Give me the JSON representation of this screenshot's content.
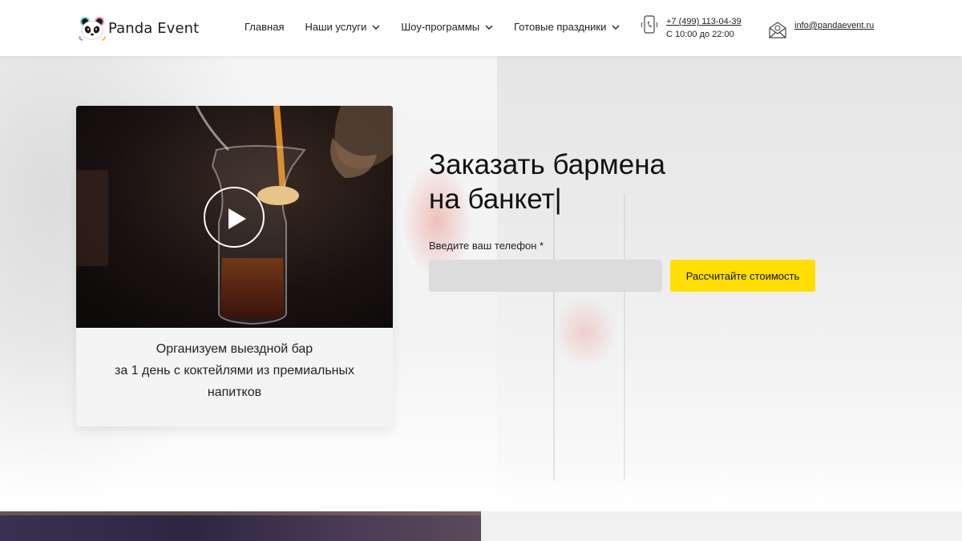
{
  "header": {
    "logo_text": "Panda Event",
    "nav": [
      {
        "label": "Главная",
        "has_dropdown": false
      },
      {
        "label": "Наши услуги",
        "has_dropdown": true
      },
      {
        "label": "Шоу-программы",
        "has_dropdown": true
      },
      {
        "label": "Готовые праздники",
        "has_dropdown": true
      }
    ],
    "phone": "+7 (499) 113-04-39",
    "hours": "С 10:00 до 22:00",
    "email": "info@pandaevent.ru"
  },
  "hero": {
    "video_caption_lines": [
      "Организуем выездной бар",
      "за 1 день с коктейлями из премиальных",
      "напитков"
    ],
    "title_line1": "Заказать бармена",
    "title_line2": "на банкет",
    "title_cursor": "|",
    "form": {
      "phone_label": "Введите ваш телефон *",
      "phone_value": "",
      "phone_placeholder": "",
      "submit_label": "Рассчитайте стоимость"
    }
  },
  "colors": {
    "accent": "#ffde00",
    "input_bg": "#dcdcdc",
    "text": "#111111"
  },
  "icons": {
    "logo": "panda-logo-icon",
    "phone": "phone-icon",
    "mail": "mail-icon",
    "play": "play-icon",
    "dropdown": "chevron-down-icon"
  }
}
